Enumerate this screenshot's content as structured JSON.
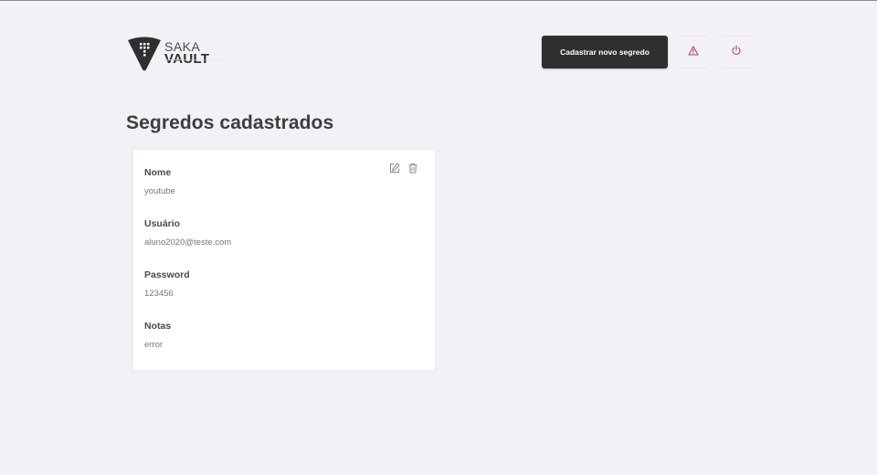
{
  "header": {
    "logo": {
      "top_text": "SAKA",
      "bottom_text": "VAULT"
    },
    "new_secret_button": "Cadastrar novo segredo",
    "alert_icon": "alert-triangle-icon",
    "logout_icon": "power-icon"
  },
  "main": {
    "title": "Segredos cadastrados",
    "secrets": [
      {
        "name_label": "Nome",
        "name_value": "youtube",
        "user_label": "Usuário",
        "user_value": "aluno2020@teste.com",
        "password_label": "Password",
        "password_value": "123456",
        "notes_label": "Notas",
        "notes_value": "error",
        "edit_icon": "edit-icon",
        "delete_icon": "trash-icon"
      }
    ]
  },
  "colors": {
    "background": "#f3f1f6",
    "primary_button": "#2f2f2f",
    "icon_accent": "#b0485f"
  }
}
